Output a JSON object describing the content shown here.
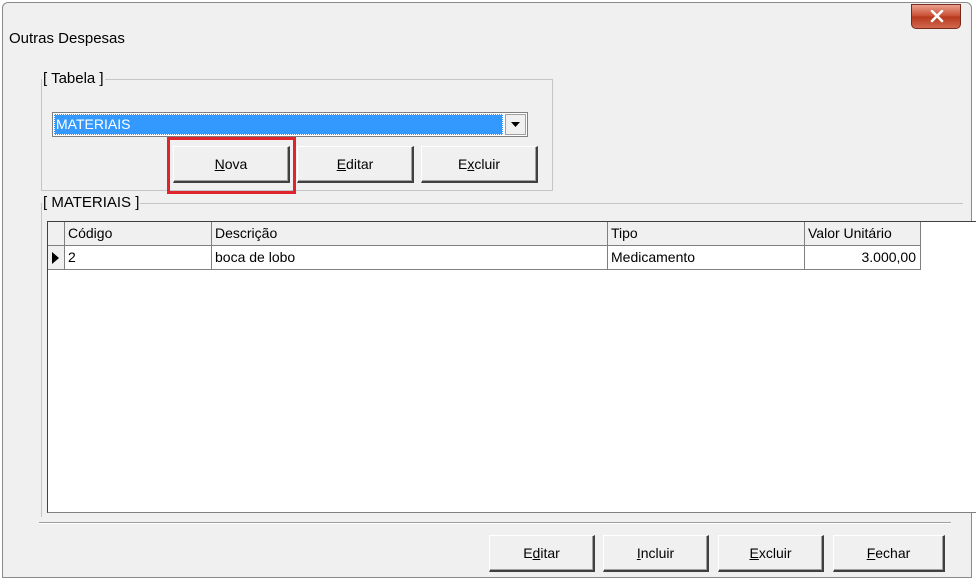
{
  "window": {
    "title": "Outras Despesas"
  },
  "tabela_group": {
    "legend": "[ Tabela ]",
    "combo": {
      "selected": "MATERIAIS"
    },
    "buttons": {
      "nova": {
        "pre": "",
        "key": "N",
        "post": "ova"
      },
      "editar": {
        "pre": "",
        "key": "E",
        "post": "ditar"
      },
      "excluir": {
        "pre": "E",
        "key": "x",
        "post": "cluir"
      }
    }
  },
  "materiais_group": {
    "legend": "[ MATERIAIS ]",
    "columns": [
      "Código",
      "Descrição",
      "Tipo",
      "Valor Unitário"
    ],
    "rows": [
      {
        "codigo": "2",
        "descricao": "boca de lobo",
        "tipo": "Medicamento",
        "valor": "3.000,00"
      }
    ]
  },
  "footer": {
    "editar": {
      "pre": "E",
      "key": "d",
      "post": "itar"
    },
    "incluir": {
      "pre": "",
      "key": "I",
      "post": "ncluir"
    },
    "excluir": {
      "pre": "",
      "key": "E",
      "post": "xcluir"
    },
    "fechar": {
      "pre": "",
      "key": "F",
      "post": "echar"
    }
  },
  "colors": {
    "highlight": "#e0242e",
    "selection": "#3399ff",
    "close_button": "#c84a2f"
  },
  "icons": {
    "close": "close-icon",
    "dropdown": "chevron-down-icon",
    "row_indicator": "row-pointer-icon"
  }
}
